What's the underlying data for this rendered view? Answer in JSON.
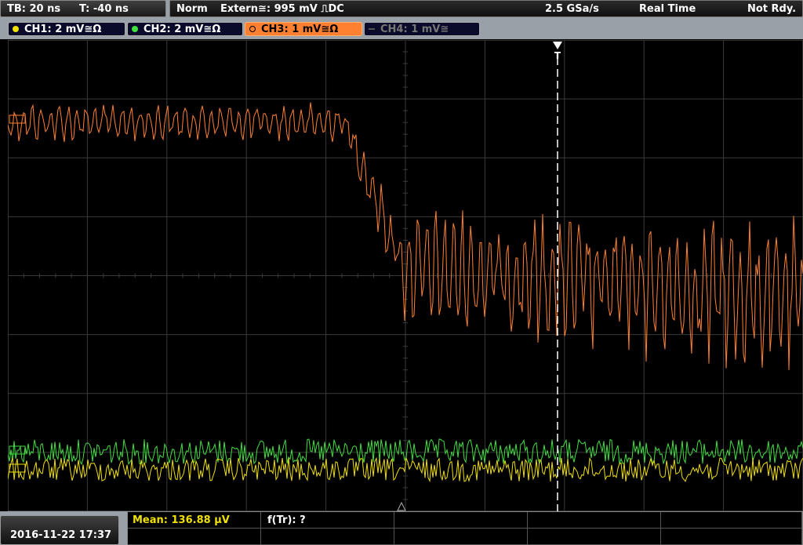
{
  "header": {
    "timebase": "TB: 20 ns",
    "trigger_time": "T: -40 ns",
    "mode": "Norm",
    "trigger_source": "Extern≅: 995 mV ⎍DC",
    "sample_rate": "2.5 GSa/s",
    "acq_mode": "Real Time",
    "status": "Not Rdy."
  },
  "channels": [
    {
      "label": "CH1: 2 mV≅Ω",
      "color": "#f0e000",
      "active": true
    },
    {
      "label": "CH2: 2 mV≅Ω",
      "color": "#40e040",
      "active": true
    },
    {
      "label": "CH3: 1 mV≅Ω",
      "color": "#ff8020",
      "active": true,
      "selected": true
    },
    {
      "label": "CH4: 1 mV≅",
      "color": "#707070",
      "active": false
    }
  ],
  "footer": {
    "datetime": "2016-11-22 17:37",
    "mean": "Mean: 136.88 µV",
    "ftr": "f(Tr): ?"
  },
  "colors": {
    "ch1": "#f0e000",
    "ch2": "#40e040",
    "ch3": "#ff8030",
    "grid": "#3a3a3a"
  }
}
